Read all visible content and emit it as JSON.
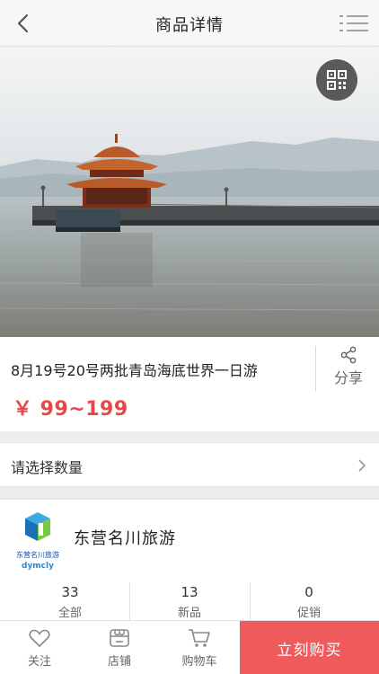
{
  "header": {
    "title": "商品详情"
  },
  "product": {
    "title": "8月19号20号两批青岛海底世界一日游",
    "price": "￥ 99~199",
    "share_label": "分享"
  },
  "quantity": {
    "label": "请选择数量"
  },
  "shop": {
    "name": "东营名川旅游",
    "logo_cn": "东营名川旅游",
    "logo_en": "dymcly",
    "stats": [
      {
        "value": "33",
        "label": "全部"
      },
      {
        "value": "13",
        "label": "新品"
      },
      {
        "value": "0",
        "label": "促销"
      }
    ]
  },
  "bottom_bar": {
    "follow_label": "关注",
    "store_label": "店铺",
    "cart_label": "购物车",
    "buy_label": "立刻购买"
  },
  "colors": {
    "accent": "#e8474a",
    "buy_button": "#ef5b5c"
  },
  "icons": [
    "back-icon",
    "menu-icon",
    "qr-code-icon",
    "share-icon",
    "chevron-right-icon",
    "heart-icon",
    "store-icon",
    "cart-icon"
  ]
}
